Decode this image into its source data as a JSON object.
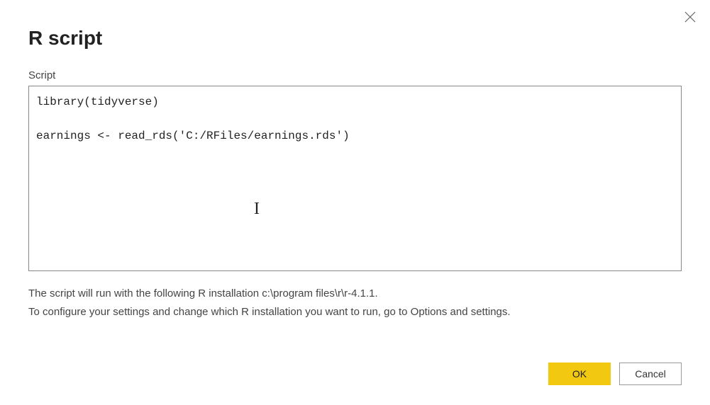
{
  "dialog": {
    "title": "R script",
    "close_label": "Close"
  },
  "script": {
    "label": "Script",
    "content": "library(tidyverse)\n\nearnings <- read_rds('C:/RFiles/earnings.rds')"
  },
  "info": {
    "line1": "The script will run with the following R installation c:\\program files\\r\\r-4.1.1.",
    "line2": "To configure your settings and change which R installation you want to run, go to Options and settings."
  },
  "buttons": {
    "ok": "OK",
    "cancel": "Cancel"
  }
}
